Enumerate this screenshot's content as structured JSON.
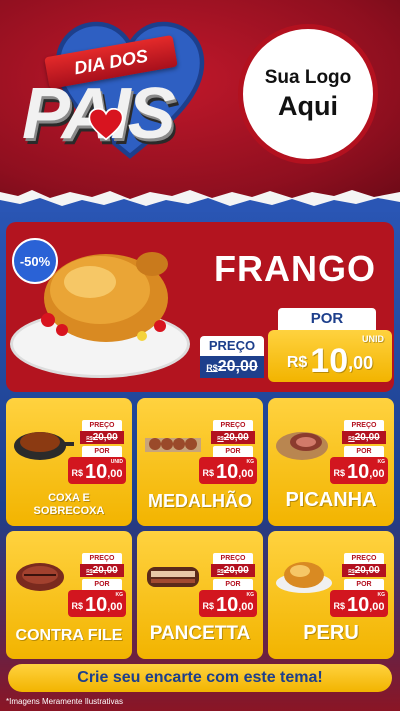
{
  "header": {
    "ribbon_text": "DIA DOS",
    "title": "PAIS",
    "logo_line1": "Sua Logo",
    "logo_line2": "Aqui"
  },
  "hero": {
    "discount_badge": "-50%",
    "product_name": "FRANGO",
    "preco_label": "PREÇO",
    "old_currency": "R$",
    "old_price": "20,00",
    "por_label": "POR",
    "currency": "R$",
    "price_int": "10",
    "price_dec": ",00",
    "unit": "UNID"
  },
  "products": [
    {
      "name_line1": "COXA E",
      "name_line2": "SOBRECOXA",
      "preco_label": "PREÇO",
      "old_currency": "R$",
      "old_price": "20,00",
      "por_label": "POR",
      "currency": "R$",
      "price_int": "10",
      "price_dec": ",00",
      "unit": "UNID",
      "icon": "chicken-pan-icon"
    },
    {
      "name_line1": "MEDALHÃO",
      "name_line2": "",
      "preco_label": "PREÇO",
      "old_currency": "R$",
      "old_price": "20,00",
      "por_label": "POR",
      "currency": "R$",
      "price_int": "10",
      "price_dec": ",00",
      "unit": "KG",
      "icon": "skewers-icon"
    },
    {
      "name_line1": "PICANHA",
      "name_line2": "",
      "preco_label": "PREÇO",
      "old_currency": "R$",
      "old_price": "20,00",
      "por_label": "POR",
      "currency": "R$",
      "price_int": "10",
      "price_dec": ",00",
      "unit": "KG",
      "icon": "steak-board-icon"
    },
    {
      "name_line1": "CONTRA FILE",
      "name_line2": "",
      "preco_label": "PREÇO",
      "old_currency": "R$",
      "old_price": "20,00",
      "por_label": "POR",
      "currency": "R$",
      "price_int": "10",
      "price_dec": ",00",
      "unit": "KG",
      "icon": "steak-icon"
    },
    {
      "name_line1": "PANCETTA",
      "name_line2": "",
      "preco_label": "PREÇO",
      "old_currency": "R$",
      "old_price": "20,00",
      "por_label": "POR",
      "currency": "R$",
      "price_int": "10",
      "price_dec": ",00",
      "unit": "KG",
      "icon": "pork-belly-icon"
    },
    {
      "name_line1": "PERU",
      "name_line2": "",
      "preco_label": "PREÇO",
      "old_currency": "R$",
      "old_price": "20,00",
      "por_label": "POR",
      "currency": "R$",
      "price_int": "10",
      "price_dec": ",00",
      "unit": "KG",
      "icon": "turkey-icon"
    }
  ],
  "cta": "Crie seu encarte com este tema!",
  "footnote": "*Imagens Meramente Ilustrativas",
  "colors": {
    "red": "#b3111f",
    "blue": "#1d3f8c",
    "yellow": "#f2b400"
  }
}
